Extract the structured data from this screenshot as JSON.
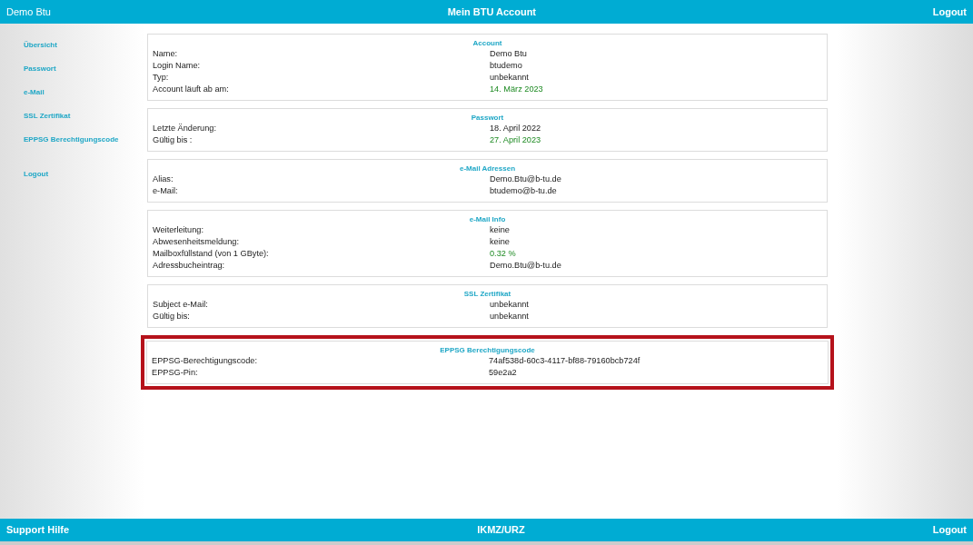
{
  "header": {
    "user": "Demo Btu",
    "title": "Mein BTU Account",
    "logout": "Logout"
  },
  "sidebar": {
    "items": [
      {
        "label": "Übersicht"
      },
      {
        "label": "Passwort"
      },
      {
        "label": "e-Mail"
      },
      {
        "label": "SSL Zertifikat"
      },
      {
        "label": "EPPSG Berechtigungscode"
      }
    ],
    "logout": "Logout"
  },
  "sections": [
    {
      "title": "Account",
      "marked": false,
      "rows": [
        {
          "label": "Name:",
          "value": "Demo Btu",
          "highlighted": false
        },
        {
          "label": "Login Name:",
          "value": "btudemo",
          "highlighted": false
        },
        {
          "label": "Typ:",
          "value": "unbekannt",
          "highlighted": false
        },
        {
          "label": "Account läuft ab am:",
          "value": "14. März 2023",
          "highlighted": true
        }
      ]
    },
    {
      "title": "Passwort",
      "marked": false,
      "rows": [
        {
          "label": "Letzte Änderung:",
          "value": "18. April 2022",
          "highlighted": false
        },
        {
          "label": "Gültig bis :",
          "value": "27. April 2023",
          "highlighted": true
        }
      ]
    },
    {
      "title": "e-Mail Adressen",
      "marked": false,
      "rows": [
        {
          "label": "Alias:",
          "value": "Demo.Btu@b-tu.de",
          "highlighted": false
        },
        {
          "label": "e-Mail:",
          "value": "btudemo@b-tu.de",
          "highlighted": false
        }
      ]
    },
    {
      "title": "e-Mail Info",
      "marked": false,
      "rows": [
        {
          "label": "Weiterleitung:",
          "value": "keine",
          "highlighted": false
        },
        {
          "label": "Abwesenheitsmeldung:",
          "value": "keine",
          "highlighted": false
        },
        {
          "label": "Mailboxfüllstand (von 1 GByte):",
          "value": "0.32 %",
          "highlighted": true
        },
        {
          "label": "Adressbucheintrag:",
          "value": "Demo.Btu@b-tu.de",
          "highlighted": false
        }
      ]
    },
    {
      "title": "SSL Zertifikat",
      "marked": false,
      "rows": [
        {
          "label": "Subject e-Mail:",
          "value": "unbekannt",
          "highlighted": false
        },
        {
          "label": "Gültig bis:",
          "value": "unbekannt",
          "highlighted": false
        }
      ]
    },
    {
      "title": "EPPSG Berechtigungscode",
      "marked": true,
      "rows": [
        {
          "label": "EPPSG-Berechtigungscode:",
          "value": "74af538d-60c3-4117-bf88-79160bcb724f",
          "highlighted": false
        },
        {
          "label": "EPPSG-Pin:",
          "value": "59e2a2",
          "highlighted": false
        }
      ]
    }
  ],
  "footer": {
    "support": "Support Hilfe",
    "org": "IKMZ/URZ",
    "logout": "Logout"
  }
}
